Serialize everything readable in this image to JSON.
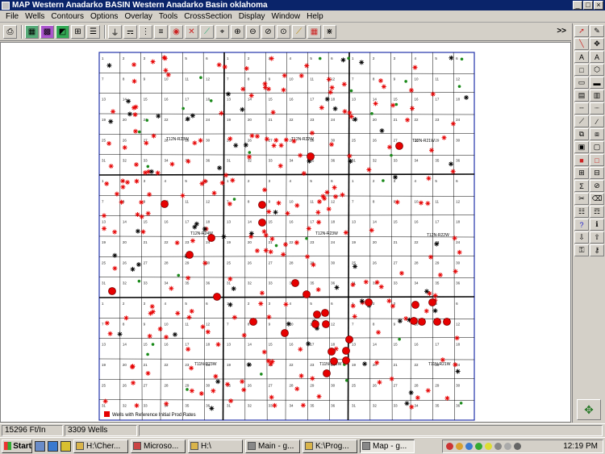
{
  "window": {
    "title": "MAP   Western Anadarko BASIN   Western Anadarko Basin   oklahoma",
    "controls": [
      "_",
      "□",
      "×"
    ]
  },
  "menu": [
    "File",
    "Wells",
    "Contours",
    "Options",
    "Overlay",
    "Tools",
    "CrossSection",
    "Display",
    "Window",
    "Help"
  ],
  "toolbar": {
    "more_label": ">>"
  },
  "map": {
    "township_labels": [
      {
        "text": "T12N-R23W"
      },
      {
        "text": "T12N-R22W"
      },
      {
        "text": "T12N-R21W"
      },
      {
        "text": "T12N-R24W"
      },
      {
        "text": "T12N-R23W"
      },
      {
        "text": "T12N-R22W"
      },
      {
        "text": "T11N-R23W"
      },
      {
        "text": "T11N-R22W"
      },
      {
        "text": "T11N-R21W"
      }
    ],
    "legend_text": "Wells with Reference Initial Prod Rates",
    "colors": {
      "grid": "#000000",
      "border": "#2233aa",
      "well_dry": "#000000",
      "well_gas": "#e60000",
      "well_oil": "#1a8a1a",
      "highlight": "#e60000"
    }
  },
  "status": {
    "scale": "15296 Ft/In",
    "wells": "3309 Wells"
  },
  "taskbar": {
    "start_label": "Start",
    "tasks": [
      {
        "label": "H:\\Cher..."
      },
      {
        "label": "Microso..."
      },
      {
        "label": "H:\\"
      },
      {
        "label": "Main - g..."
      },
      {
        "label": "K:\\Prog..."
      },
      {
        "label": "Map - g..."
      }
    ],
    "clock": "12:19 PM"
  }
}
